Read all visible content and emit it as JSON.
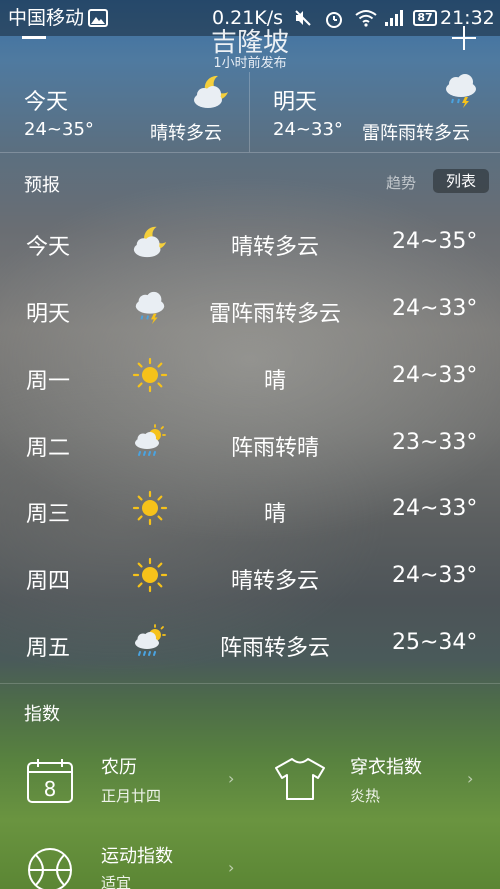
{
  "status_bar": {
    "carrier": "中国移动",
    "speed": "0.21K/s",
    "battery": "87",
    "time": "21:32"
  },
  "header": {
    "city": "吉隆坡",
    "published": "1小时前发布"
  },
  "summary": [
    {
      "day": "今天",
      "temp": "24~35°",
      "condition": "晴转多云",
      "icon": "moon-cloud-icon"
    },
    {
      "day": "明天",
      "temp": "24~33°",
      "condition": "雷阵雨转多云",
      "icon": "thunderstorm-cloud-icon"
    }
  ],
  "forecast": {
    "title": "预报",
    "toggle_trend": "趋势",
    "toggle_list": "列表",
    "days": [
      {
        "day": "今天",
        "condition": "晴转多云",
        "temp": "24~35°",
        "icon": "moon-cloud-icon"
      },
      {
        "day": "明天",
        "condition": "雷阵雨转多云",
        "temp": "24~33°",
        "icon": "thunderstorm-cloud-icon"
      },
      {
        "day": "周一",
        "condition": "晴",
        "temp": "24~33°",
        "icon": "sun-icon"
      },
      {
        "day": "周二",
        "condition": "阵雨转晴",
        "temp": "23~33°",
        "icon": "sun-rain-cloud-icon"
      },
      {
        "day": "周三",
        "condition": "晴",
        "temp": "24~33°",
        "icon": "sun-icon"
      },
      {
        "day": "周四",
        "condition": "晴转多云",
        "temp": "24~33°",
        "icon": "sun-icon"
      },
      {
        "day": "周五",
        "condition": "阵雨转多云",
        "temp": "25~34°",
        "icon": "sun-rain-cloud-icon"
      }
    ]
  },
  "indices": {
    "title": "指数",
    "items": [
      {
        "name": "农历",
        "value": "正月廿四",
        "icon": "calendar-icon",
        "calendar_digit": "8"
      },
      {
        "name": "穿衣指数",
        "value": "炎热",
        "icon": "tshirt-icon"
      },
      {
        "name": "运动指数",
        "value": "适宜",
        "icon": "basketball-icon"
      }
    ],
    "chevron": "›"
  },
  "colors": {
    "sun": "#f6c21a",
    "cloud": "#e9eef3",
    "moon": "#f4cf3c",
    "rain": "#4aa3e0"
  }
}
